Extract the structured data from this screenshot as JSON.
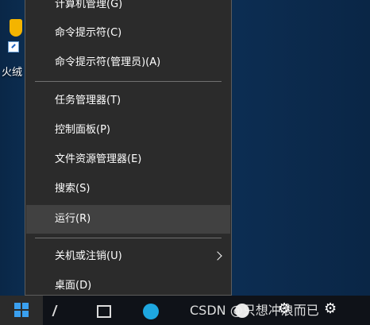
{
  "desktop": {
    "icon_label": "火绒"
  },
  "menu": {
    "items": [
      {
        "label": "计算机管理(G)"
      },
      {
        "label": "命令提示符(C)"
      },
      {
        "label": "命令提示符(管理员)(A)"
      },
      {
        "label": "任务管理器(T)"
      },
      {
        "label": "控制面板(P)"
      },
      {
        "label": "文件资源管理器(E)"
      },
      {
        "label": "搜索(S)"
      },
      {
        "label": "运行(R)",
        "highlighted": true
      },
      {
        "label": "关机或注销(U)",
        "has_submenu": true
      },
      {
        "label": "桌面(D)"
      }
    ]
  },
  "taskbar": {
    "icons": [
      "windows-logo-icon",
      "search-icon",
      "task-view-icon",
      "browser-icon",
      "app-icon",
      "settings-icon",
      "gear-icon"
    ]
  },
  "watermark": {
    "text": "CSDN @只想冲浪而已"
  },
  "colors": {
    "menu_bg": "#2b2b2b",
    "menu_hover": "#414141",
    "separator": "#707070",
    "taskbar_bg": "#0f1218",
    "windows_blue": "#3aa0f0"
  }
}
